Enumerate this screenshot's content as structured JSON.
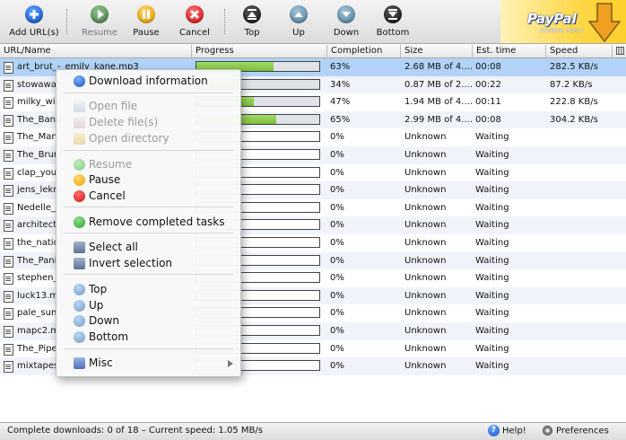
{
  "toolbar": {
    "buttons": [
      {
        "label": "Add URL(s)",
        "icon": "plus-icon",
        "enabled": true
      },
      {
        "label": "Resume",
        "icon": "play-icon",
        "enabled": false
      },
      {
        "label": "Pause",
        "icon": "pause-icon",
        "enabled": true
      },
      {
        "label": "Cancel",
        "icon": "cancel-x-icon",
        "enabled": true
      },
      {
        "label": "Top",
        "icon": "move-top-icon",
        "enabled": true
      },
      {
        "label": "Up",
        "icon": "move-up-icon",
        "enabled": true
      },
      {
        "label": "Down",
        "icon": "move-down-icon",
        "enabled": true
      },
      {
        "label": "Bottom",
        "icon": "move-bottom-icon",
        "enabled": true
      }
    ]
  },
  "paypal": {
    "brand": "PayPal",
    "donate": "DONATE HERE!"
  },
  "table": {
    "columns": [
      "URL/Name",
      "Progress",
      "Completion",
      "Size",
      "Est. time",
      "Speed"
    ],
    "rows": [
      {
        "name": "art_brut_-_emily_kane.mp3",
        "progress": 0.63,
        "completion": "63%",
        "size": "2.68 MB of 4....",
        "est": "00:08",
        "speed": "282.5 KB/s"
      },
      {
        "name": "stowaway",
        "progress": 0.34,
        "completion": "34%",
        "size": "0.87 MB of 2....",
        "est": "00:22",
        "speed": "87.2 KB/s"
      },
      {
        "name": "milky_wir",
        "progress": 0.47,
        "completion": "47%",
        "size": "1.94 MB of 4....",
        "est": "00:11",
        "speed": "222.8 KB/s"
      },
      {
        "name": "The_Bank",
        "progress": 0.65,
        "completion": "65%",
        "size": "2.99 MB of 4....",
        "est": "00:08",
        "speed": "304.2 KB/s"
      },
      {
        "name": "The_Man",
        "progress": 0,
        "completion": "0%",
        "size": "Unknown",
        "est": "Waiting",
        "speed": ""
      },
      {
        "name": "The_Brun",
        "progress": 0,
        "completion": "0%",
        "size": "Unknown",
        "est": "Waiting",
        "speed": ""
      },
      {
        "name": "clap_you",
        "progress": 0,
        "completion": "0%",
        "size": "Unknown",
        "est": "Waiting",
        "speed": ""
      },
      {
        "name": "jens_lekn",
        "progress": 0,
        "completion": "0%",
        "size": "Unknown",
        "est": "Waiting",
        "speed": ""
      },
      {
        "name": "Nedelle_",
        "progress": 0,
        "completion": "0%",
        "size": "Unknown",
        "est": "Waiting",
        "speed": ""
      },
      {
        "name": "architect",
        "progress": 0,
        "completion": "0%",
        "size": "Unknown",
        "est": "Waiting",
        "speed": ""
      },
      {
        "name": "the_nation",
        "progress": 0,
        "completion": "0%",
        "size": "Unknown",
        "est": "Waiting",
        "speed": ""
      },
      {
        "name": "The_Panic",
        "progress": 0,
        "completion": "0%",
        "size": "Unknown",
        "est": "Waiting",
        "speed": ""
      },
      {
        "name": "stephen_",
        "progress": 0,
        "completion": "0%",
        "size": "Unknown",
        "est": "Waiting",
        "speed": ""
      },
      {
        "name": "luck13.m",
        "progress": 0,
        "completion": "0%",
        "size": "Unknown",
        "est": "Waiting",
        "speed": ""
      },
      {
        "name": "pale_sun",
        "progress": 0,
        "completion": "0%",
        "size": "Unknown",
        "est": "Waiting",
        "speed": ""
      },
      {
        "name": "mapc2.m",
        "progress": 0,
        "completion": "0%",
        "size": "Unknown",
        "est": "Waiting",
        "speed": ""
      },
      {
        "name": "The_Pipe",
        "progress": 0,
        "completion": "0%",
        "size": "Unknown",
        "est": "Waiting",
        "speed": ""
      },
      {
        "name": "mixtapes",
        "progress": 0,
        "completion": "0%",
        "size": "Unknown",
        "est": "Waiting",
        "speed": ""
      }
    ]
  },
  "context_menu": {
    "items": [
      {
        "label": "Download information",
        "icon": "info-icon",
        "enabled": true
      },
      {
        "label": "Open file",
        "icon": "open-file-icon",
        "enabled": false
      },
      {
        "label": "Delete file(s)",
        "icon": "delete-file-icon",
        "enabled": false
      },
      {
        "label": "Open directory",
        "icon": "folder-icon",
        "enabled": false
      },
      {
        "label": "Resume",
        "icon": "play-icon",
        "enabled": false
      },
      {
        "label": "Pause",
        "icon": "pause-icon",
        "enabled": true
      },
      {
        "label": "Cancel",
        "icon": "cancel-x-icon",
        "enabled": true
      },
      {
        "label": "Remove completed tasks",
        "icon": "checkmark-icon",
        "enabled": true
      },
      {
        "label": "Select all",
        "icon": "select-all-icon",
        "enabled": true
      },
      {
        "label": "Invert selection",
        "icon": "invert-selection-icon",
        "enabled": true
      },
      {
        "label": "Top",
        "icon": "move-top-icon",
        "enabled": true
      },
      {
        "label": "Up",
        "icon": "move-up-icon",
        "enabled": true
      },
      {
        "label": "Down",
        "icon": "move-down-icon",
        "enabled": true
      },
      {
        "label": "Bottom",
        "icon": "move-bottom-icon",
        "enabled": true
      },
      {
        "label": "Misc",
        "icon": "misc-icon",
        "enabled": true
      }
    ]
  },
  "status": {
    "text": "Complete downloads: 0 of 18 – Current speed: 1.05 MB/s",
    "help": "Help!",
    "preferences": "Preferences"
  },
  "colors": {
    "progress_fill": "#8ccc4c",
    "selection": "#b2d3f7",
    "accent": "#1250c8"
  }
}
